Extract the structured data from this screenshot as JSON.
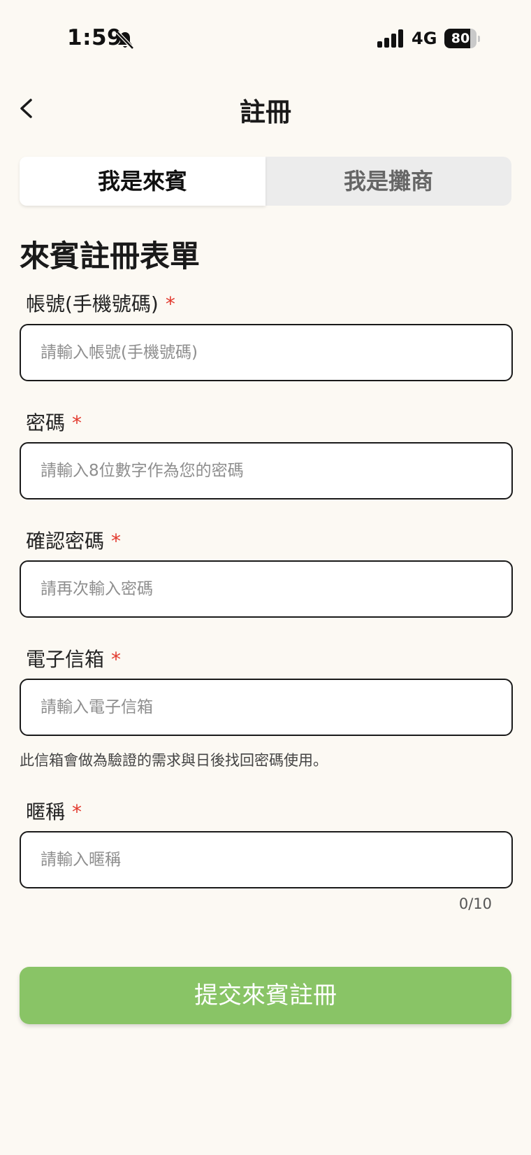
{
  "status_bar": {
    "time": "1:59",
    "network": "4G",
    "battery_level": "80",
    "battery_fraction": 0.8
  },
  "nav": {
    "title": "註冊",
    "back_icon": "chevron-left-icon"
  },
  "tabs": [
    {
      "label": "我是來賓",
      "active": true
    },
    {
      "label": "我是攤商",
      "active": false
    }
  ],
  "form": {
    "title": "來賓註冊表單",
    "required_mark": "*",
    "fields": {
      "account": {
        "label": "帳號(手機號碼)",
        "placeholder": "請輸入帳號(手機號碼)",
        "value": ""
      },
      "password": {
        "label": "密碼",
        "placeholder": "請輸入8位數字作為您的密碼",
        "value": ""
      },
      "confirm_password": {
        "label": "確認密碼",
        "placeholder": "請再次輸入密碼",
        "value": ""
      },
      "email": {
        "label": "電子信箱",
        "placeholder": "請輸入電子信箱",
        "value": "",
        "hint": "此信箱會做為驗證的需求與日後找回密碼使用。"
      },
      "nickname": {
        "label": "暱稱",
        "placeholder": "請輸入暱稱",
        "value": "",
        "counter": "0/10"
      }
    },
    "submit_label": "提交來賓註冊"
  },
  "colors": {
    "background": "#fcf9f3",
    "accent": "#89c466",
    "required": "#e23a2e"
  }
}
